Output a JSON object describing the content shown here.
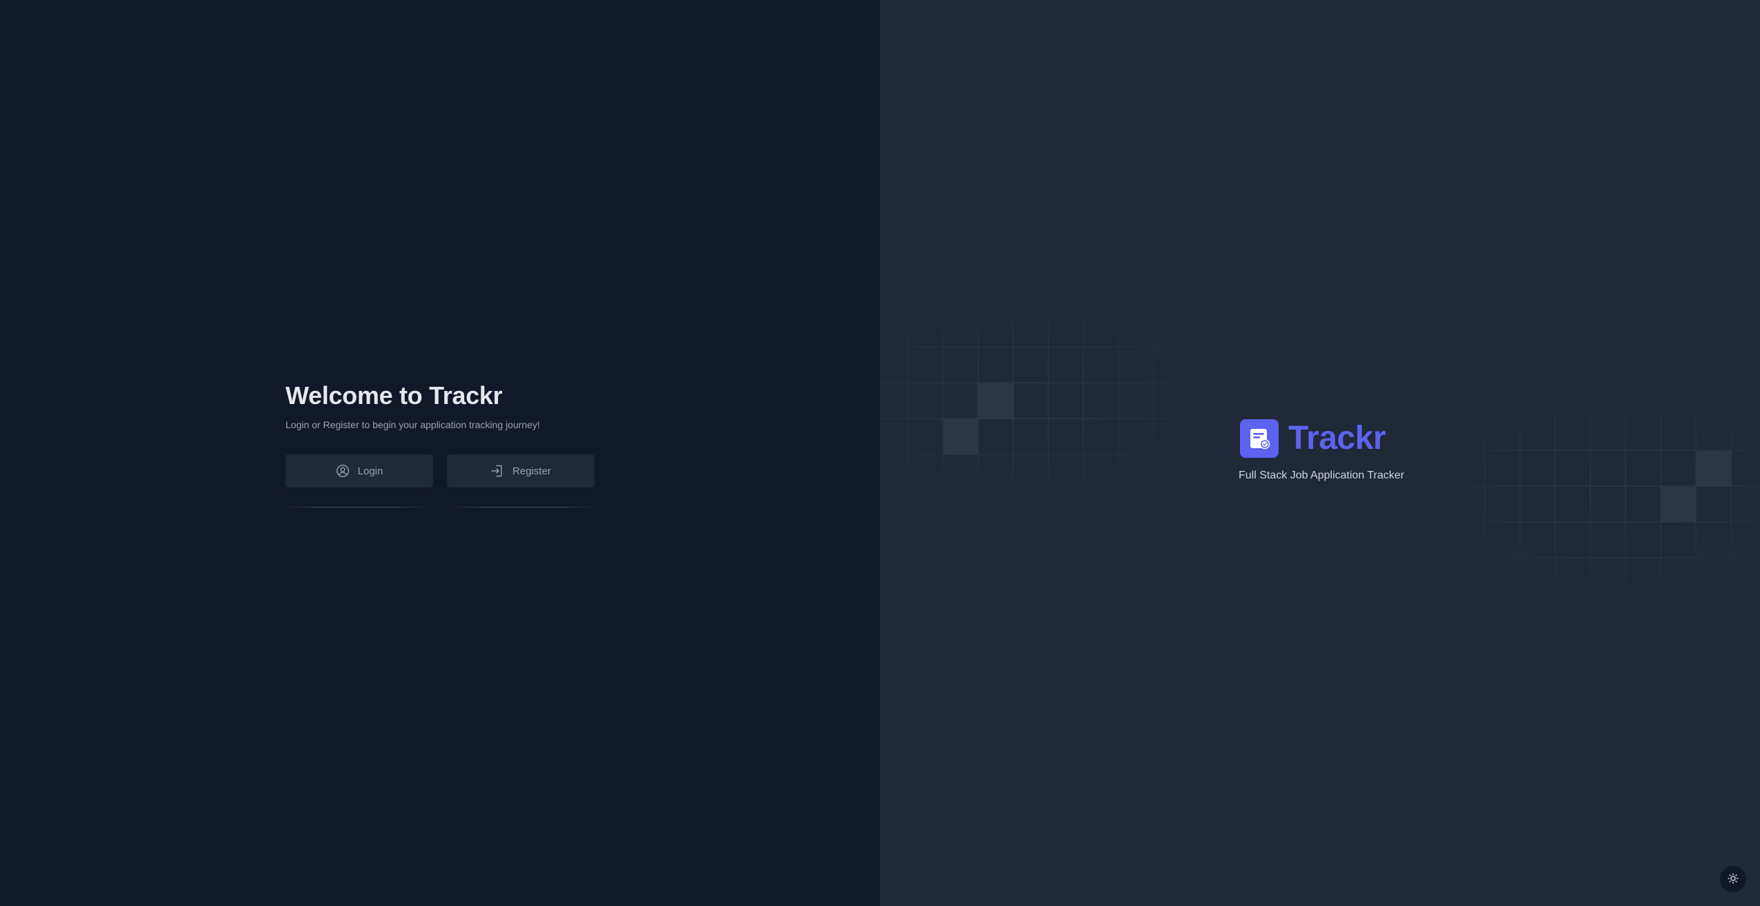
{
  "auth": {
    "title": "Welcome to Trackr",
    "subtitle": "Login or Register to begin your application tracking journey!",
    "login_label": "Login",
    "register_label": "Register"
  },
  "brand": {
    "name": "Trackr",
    "tagline": "Full Stack Job Application Tracker",
    "logo_icon": "document-check-icon"
  },
  "icons": {
    "login": "user-circle-icon",
    "register": "login-arrow-icon",
    "theme_toggle": "sun-icon"
  },
  "colors": {
    "left_background": "#111827",
    "right_background": "#1f2937",
    "accent": "#5b63f0",
    "button_background": "#1f2937",
    "muted_text": "#9ca3af",
    "title_text": "#e5e7eb"
  }
}
